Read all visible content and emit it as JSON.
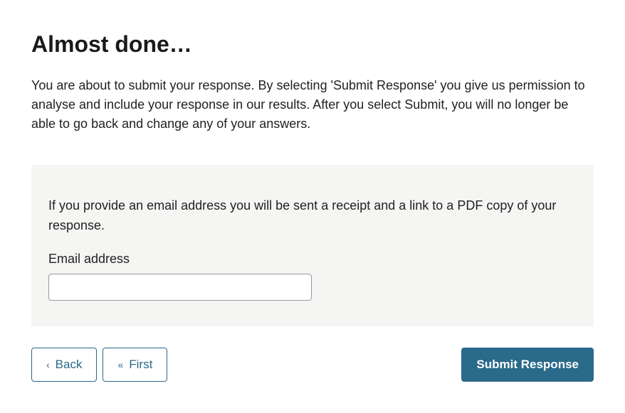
{
  "title": "Almost done…",
  "intro": "You are about to submit your response. By selecting 'Submit Response' you give us permission to analyse and include your response in our results. After you select Submit, you will no longer be able to go back and change any of your answers.",
  "emailPanel": {
    "help": "If you provide an email address you will be sent a receipt and a link to a PDF copy of your response.",
    "label": "Email address",
    "value": ""
  },
  "buttons": {
    "back": "Back",
    "first": "First",
    "submit": "Submit Response"
  }
}
